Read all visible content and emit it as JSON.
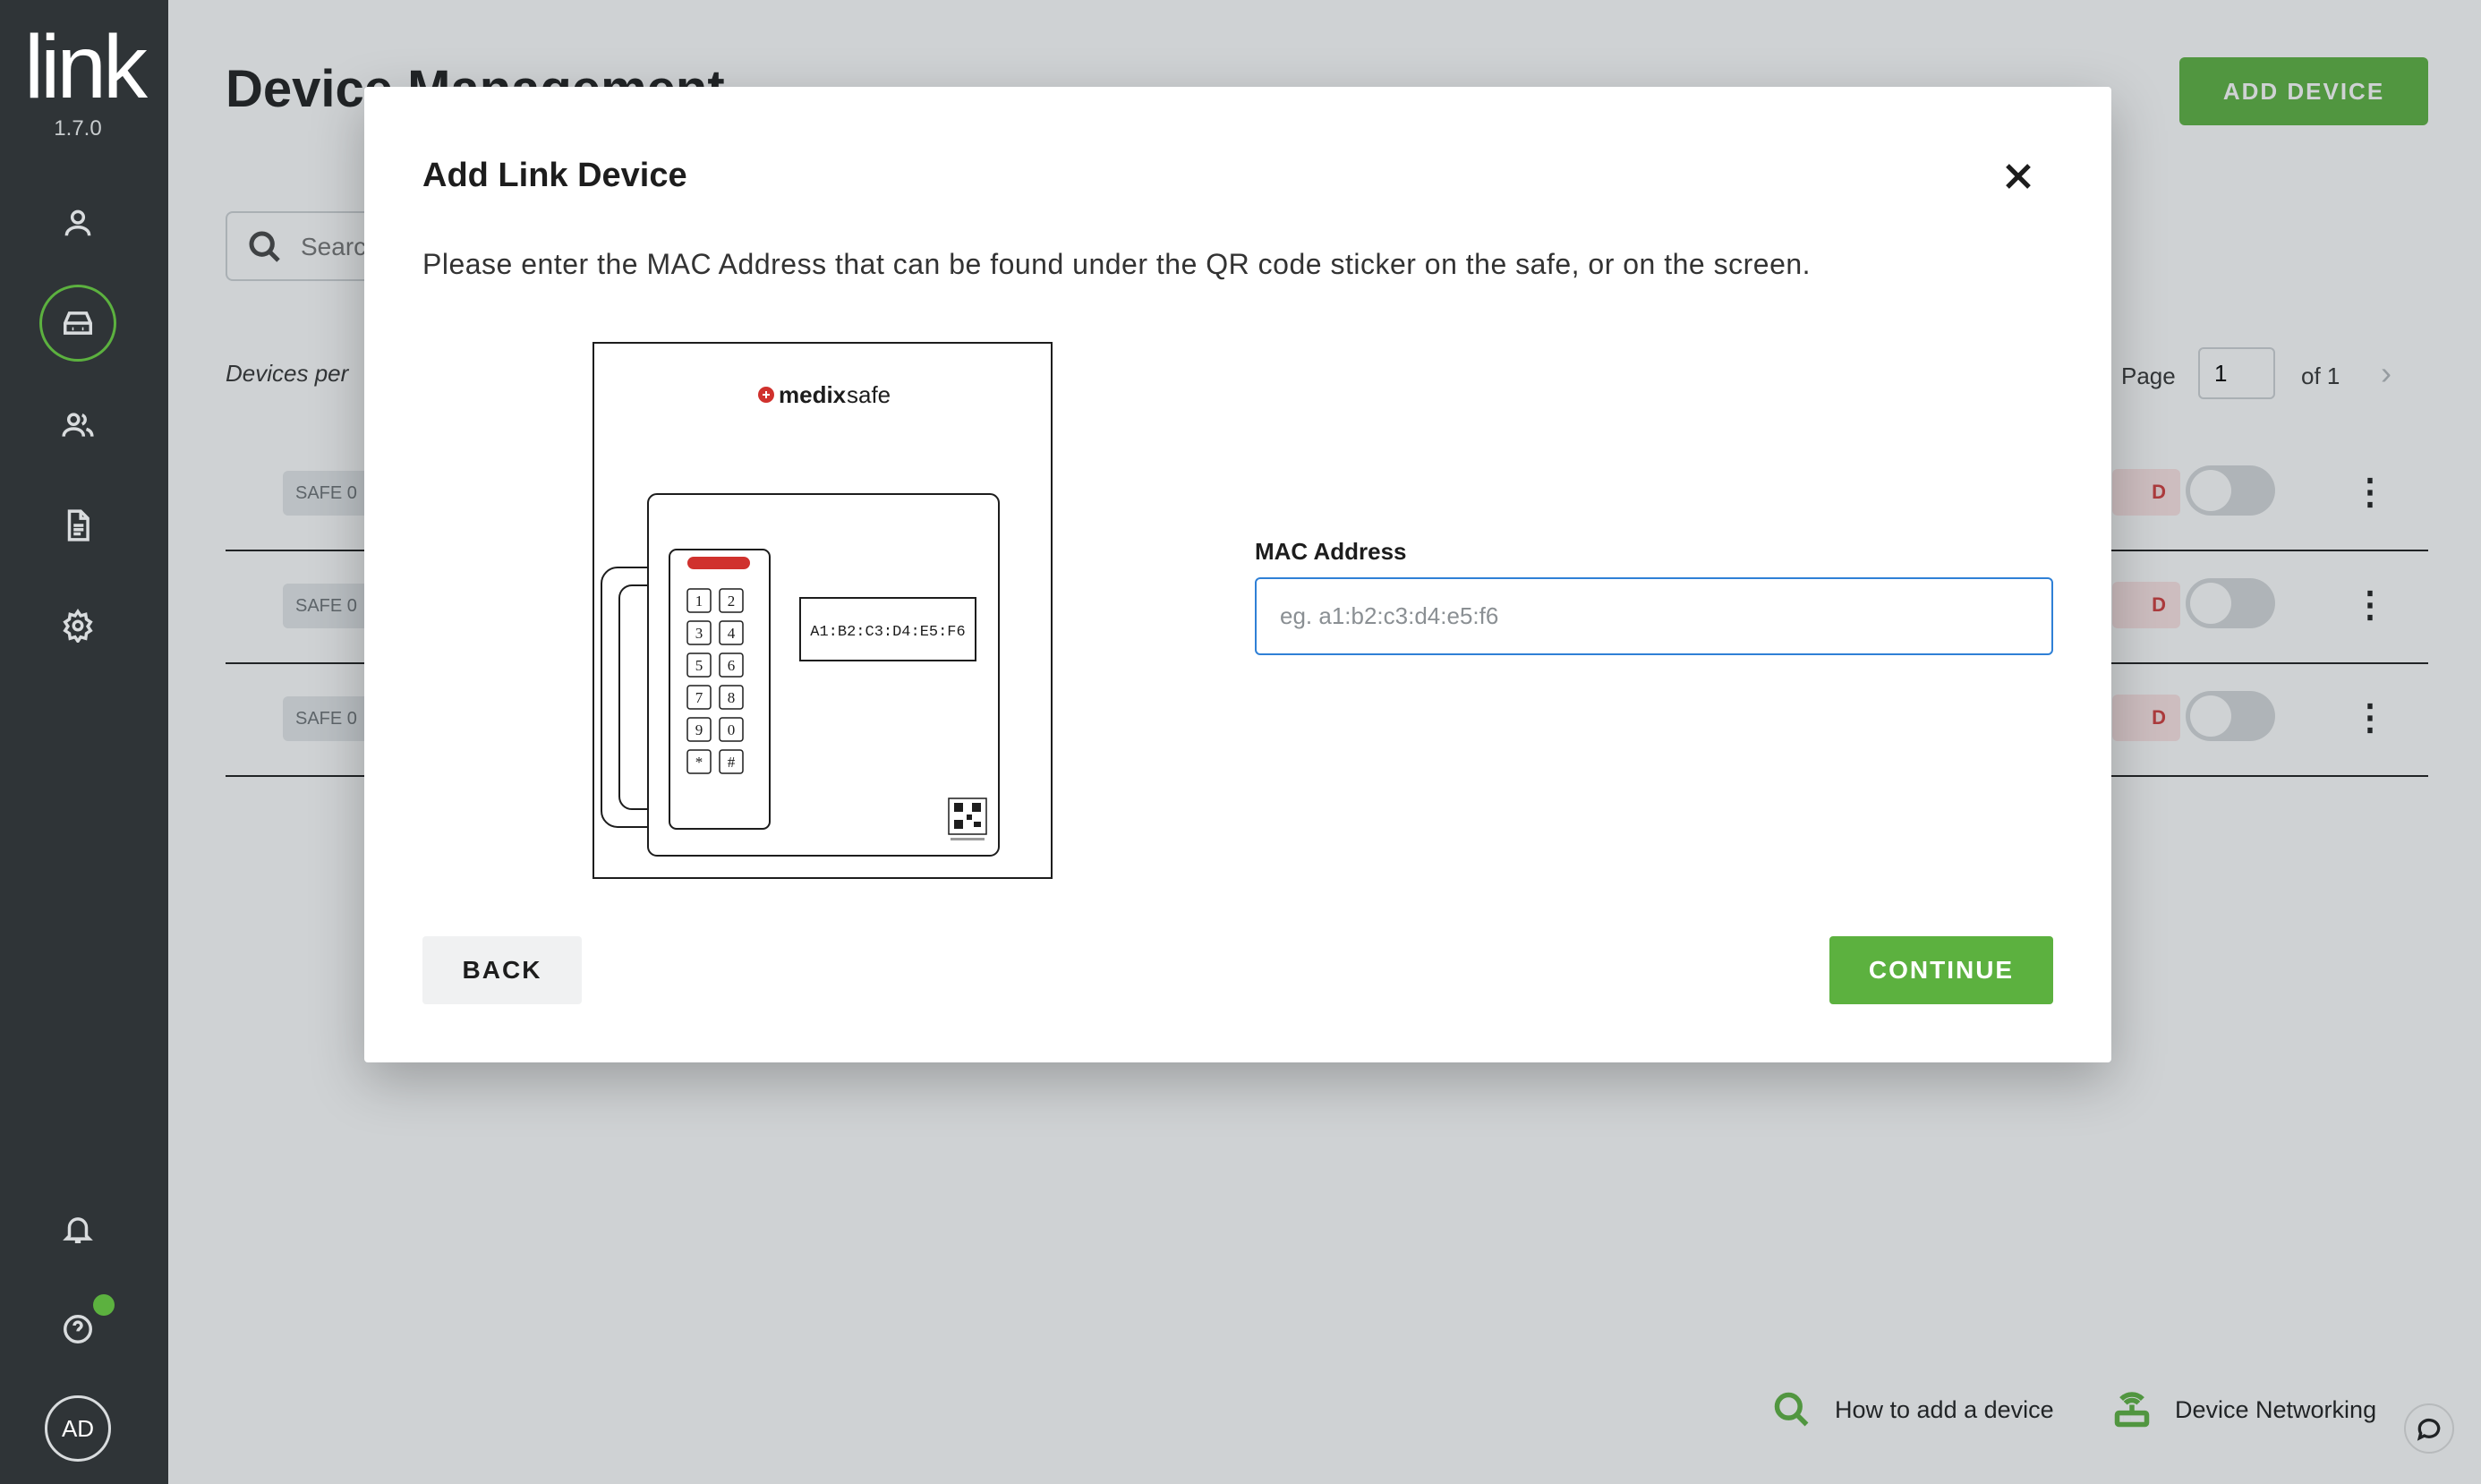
{
  "app": {
    "logo_text": "link",
    "version": "1.7.0",
    "avatar_initials": "AD",
    "accent_color": "#5cb13f"
  },
  "sidebar": {
    "items": [
      {
        "icon": "user-icon",
        "active": false
      },
      {
        "icon": "device-icon",
        "active": true
      },
      {
        "icon": "users-icon",
        "active": false
      },
      {
        "icon": "document-icon",
        "active": false
      },
      {
        "icon": "gear-icon",
        "active": false
      }
    ],
    "bottom": [
      {
        "icon": "bell-icon"
      },
      {
        "icon": "help-icon",
        "has_notification": true
      }
    ]
  },
  "page": {
    "title": "Device Management",
    "add_device_label": "ADD DEVICE",
    "search_placeholder": "Search",
    "devices_per_label": "Devices per",
    "pager": {
      "page_label": "Page",
      "page_value": "1",
      "of_label": "of 1"
    },
    "rows": [
      {
        "badge": "SAFE 0",
        "status": "D"
      },
      {
        "badge": "SAFE 0",
        "status": "D"
      },
      {
        "badge": "SAFE 0",
        "status": "D"
      }
    ],
    "footer": {
      "how_to": "How to add a device",
      "networking": "Device Networking"
    }
  },
  "modal": {
    "title": "Add Link Device",
    "description": "Please enter the MAC Address that can be found under the QR code sticker on the safe, or on the screen.",
    "illustration": {
      "brand_prefix": "medix",
      "brand_suffix": "safe",
      "mac_example": "A1:B2:C3:D4:E5:F6",
      "keys": [
        "1",
        "2",
        "3",
        "4",
        "5",
        "6",
        "7",
        "8",
        "9",
        "0",
        "*",
        "#"
      ]
    },
    "field_label": "MAC Address",
    "field_placeholder": "eg. a1:b2:c3:d4:e5:f6",
    "field_value": "",
    "back_label": "BACK",
    "continue_label": "CONTINUE"
  }
}
